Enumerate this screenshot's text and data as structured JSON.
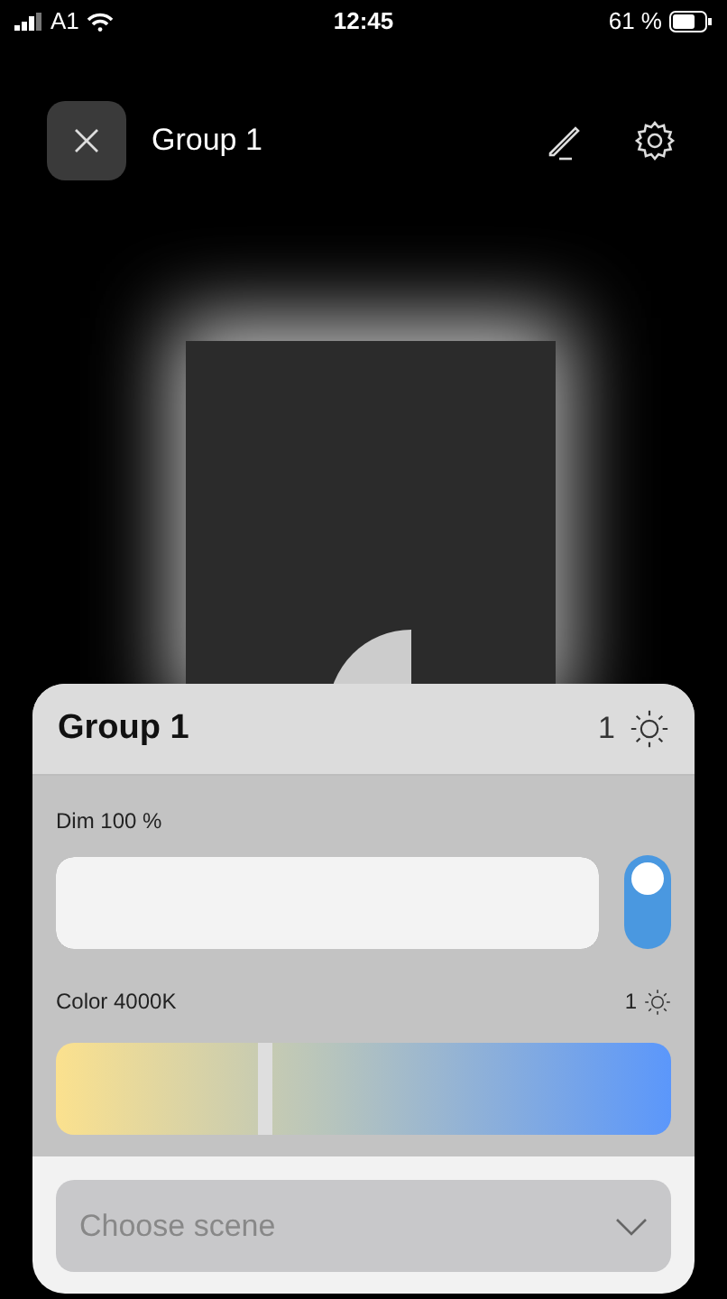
{
  "status_bar": {
    "carrier": "A1",
    "time": "12:45",
    "battery": "61 %"
  },
  "header": {
    "title": "Group 1"
  },
  "panel": {
    "title": "Group 1",
    "count": "1",
    "dim": {
      "label": "Dim 100 %",
      "level": 1,
      "on": true
    },
    "color": {
      "label": "Color 4000K",
      "count": "1",
      "level": 0.34
    },
    "scene": {
      "placeholder": "Choose scene"
    }
  }
}
